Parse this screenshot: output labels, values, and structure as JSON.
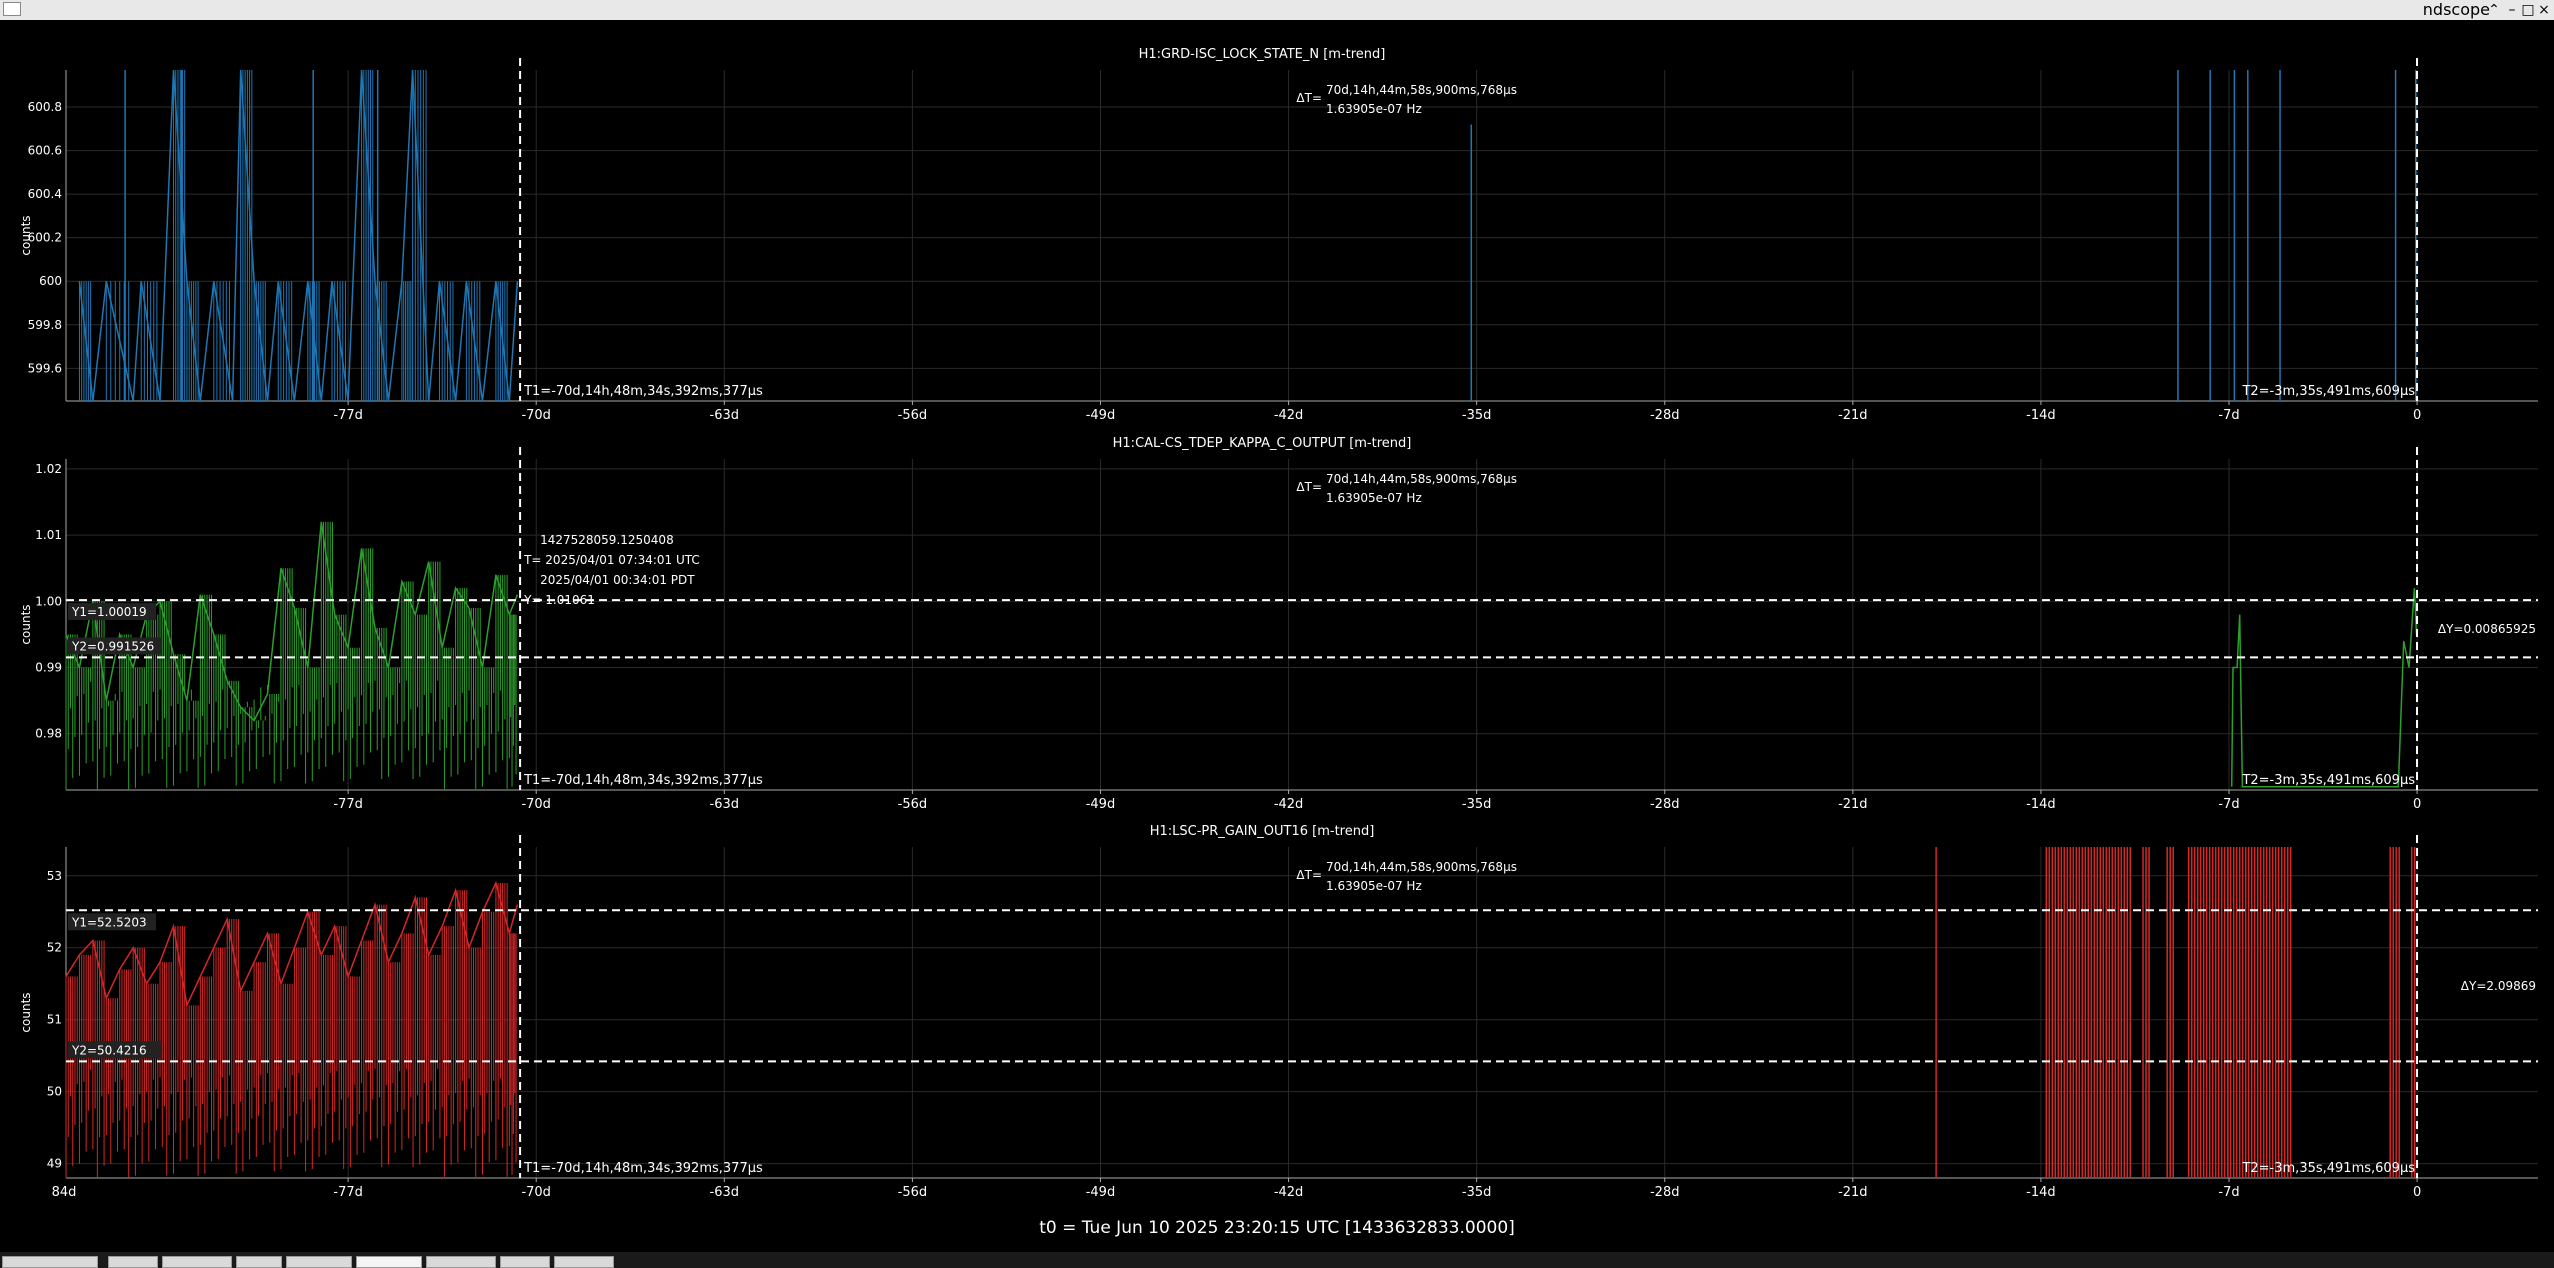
{
  "window": {
    "title": "ndscope",
    "min_glyph": "–",
    "max_glyph": "□",
    "close_glyph": "×"
  },
  "t0_label": "t0 = Tue Jun 10 2025 23:20:15 UTC [1433632833.0000]",
  "cursor_readout": {
    "delta_t": "70d,14h,44m,58s,900ms,768µs",
    "delta_t_hz": "1.63905e-07 Hz",
    "delta_t_prefix": "ΔT=",
    "t1": "T1=-70d,14h,48m,34s,392ms,377µs",
    "t2": "T2=-3m,35s,491ms,609µs"
  },
  "x_axis": {
    "range_days": [
      -87.5,
      4.5
    ],
    "ticks": [
      -77,
      -70,
      -63,
      -56,
      -49,
      -42,
      -35,
      -28,
      -21,
      -14,
      -7,
      0
    ],
    "tick_labels": [
      "-77d",
      "-70d",
      "-63d",
      "-56d",
      "-49d",
      "-42d",
      "-35d",
      "-28d",
      "-21d",
      "-14d",
      "-7d",
      "0"
    ],
    "cut_label": "84d",
    "t1_days": -70.6,
    "t2_days": -0.0025
  },
  "chart_data": [
    {
      "type": "line",
      "title": "H1:GRD-ISC_LOCK_STATE_N [m-trend]",
      "ylabel": "counts",
      "color": "#1f77b4",
      "ylim": [
        599.45,
        600.97
      ],
      "yticks": [
        599.6,
        599.8,
        600,
        600.2,
        600.4,
        600.6,
        600.8
      ],
      "ytick_labels": [
        "599.6",
        "599.8",
        "600",
        "600.2",
        "600.4",
        "600.6",
        "600.8"
      ],
      "series": [
        {
          "x": [
            -87,
            -86.5,
            -86,
            -85,
            -84.7,
            -84,
            -83.5,
            -83,
            -82.5,
            -82,
            -81.3,
            -81,
            -80.5,
            -80,
            -79.6,
            -79,
            -78.5,
            -78,
            -77.6,
            -77,
            -76.5,
            -76,
            -75.5,
            -75,
            -74.6,
            -74,
            -73.6,
            -73,
            -72.6,
            -72,
            -71.5,
            -71,
            -70.7
          ],
          "values": [
            600,
            599.45,
            600,
            599.45,
            600,
            599.45,
            600.97,
            600,
            599.45,
            600,
            599.45,
            600.97,
            600,
            599.45,
            600,
            599.45,
            600,
            599.45,
            600,
            599.45,
            600.97,
            600,
            599.45,
            600,
            600.97,
            599.45,
            600,
            599.45,
            600,
            599.45,
            600,
            599.45,
            600
          ]
        }
      ],
      "spikes": [
        -85.3,
        -83.2,
        -78.3,
        -75.9,
        -35.2,
        -8.9,
        -7.7,
        -6.8,
        -6.3,
        -5.1,
        -0.8,
        -0.05
      ],
      "spike_tops": [
        600.97,
        600.97,
        600.97,
        600.97,
        600.72,
        600.97,
        600.97,
        600.97,
        600.97,
        600.97,
        600.97,
        600.97
      ]
    },
    {
      "type": "line",
      "title": "H1:CAL-CS_TDEP_KAPPA_C_OUTPUT [m-trend]",
      "ylabel": "counts",
      "color": "#2ca02c",
      "ylim": [
        0.9715,
        1.0215
      ],
      "yticks": [
        0.98,
        0.99,
        1.0,
        1.01,
        1.02
      ],
      "ytick_labels": [
        "0.98",
        "0.99",
        "1.00",
        "1.01",
        "1.02"
      ],
      "y1_label": "Y1=1.00019",
      "y2_label": "Y2=0.991526",
      "delta_y": "ΔY=0.00865925",
      "y1": 1.00019,
      "y2": 0.991526,
      "hover": {
        "gps": "1427528059.1250408",
        "utc": "T= 2025/04/01 07:34:01 UTC",
        "pdt": "2025/04/01 00:34:01 PDT",
        "y": "Y= 1.01061"
      },
      "series": [
        {
          "x": [
            -87.5,
            -87,
            -86.5,
            -86,
            -85.5,
            -85,
            -84.5,
            -84,
            -83.5,
            -83,
            -82.5,
            -82,
            -81.5,
            -81,
            -80.5,
            -80,
            -79.5,
            -79,
            -78.5,
            -78,
            -77.5,
            -77,
            -76.5,
            -76,
            -75.5,
            -75,
            -74.5,
            -74,
            -73.5,
            -73,
            -72.5,
            -72,
            -71.5,
            -71,
            -70.7
          ],
          "values": [
            0.995,
            0.99,
            1.0,
            0.985,
            0.995,
            0.99,
            0.998,
            1.0,
            0.992,
            0.985,
            1.001,
            0.995,
            0.988,
            0.984,
            0.982,
            0.986,
            1.005,
            0.999,
            0.99,
            1.012,
            0.998,
            0.993,
            1.008,
            0.996,
            0.99,
            1.003,
            0.998,
            1.006,
            0.993,
            1.002,
            0.999,
            0.99,
            1.004,
            0.998,
            1.001
          ]
        }
      ],
      "tail": {
        "x": [
          -6.9,
          -6.85,
          -6.7,
          -6.6,
          -6.5,
          -0.7,
          -0.5,
          -0.3,
          -0.1,
          -0.02
        ],
        "values": [
          0.972,
          0.99,
          0.99,
          0.998,
          0.972,
          0.972,
          0.994,
          0.99,
          1.002,
          0.995
        ]
      }
    },
    {
      "type": "line",
      "title": "H1:LSC-PR_GAIN_OUT16 [m-trend]",
      "ylabel": "counts",
      "color": "#d62728",
      "ylim": [
        48.8,
        53.4
      ],
      "yticks": [
        49,
        50,
        51,
        52,
        53
      ],
      "ytick_labels": [
        "49",
        "50",
        "51",
        "52",
        "53"
      ],
      "y1_label": "Y1=52.5203",
      "y2_label": "Y2=50.4216",
      "delta_y": "ΔY=2.09869",
      "y1": 52.5203,
      "y2": 50.4216,
      "series": [
        {
          "x": [
            -87.5,
            -87,
            -86.5,
            -86,
            -85.5,
            -85,
            -84.5,
            -84,
            -83.5,
            -83,
            -82.5,
            -82,
            -81.5,
            -81,
            -80.5,
            -80,
            -79.5,
            -79,
            -78.5,
            -78,
            -77.5,
            -77,
            -76.5,
            -76,
            -75.5,
            -75,
            -74.5,
            -74,
            -73.5,
            -73,
            -72.5,
            -72,
            -71.5,
            -71,
            -70.7
          ],
          "values": [
            51.6,
            51.9,
            52.1,
            51.3,
            51.7,
            52.0,
            51.5,
            51.8,
            52.3,
            51.2,
            51.6,
            52.0,
            52.4,
            51.4,
            51.8,
            52.2,
            51.5,
            52.0,
            52.5,
            51.9,
            52.3,
            51.6,
            52.1,
            52.6,
            51.8,
            52.2,
            52.7,
            51.9,
            52.3,
            52.8,
            52.0,
            52.5,
            52.9,
            52.2,
            52.6
          ]
        }
      ],
      "bursts": [
        [
          -17.9,
          -17.85
        ],
        [
          -13.8,
          -10.6
        ],
        [
          -10.2,
          -9.9
        ],
        [
          -9.3,
          -9.0
        ],
        [
          -8.5,
          -4.6
        ],
        [
          -1.0,
          -0.6
        ],
        [
          -0.2,
          -0.05
        ]
      ]
    }
  ]
}
